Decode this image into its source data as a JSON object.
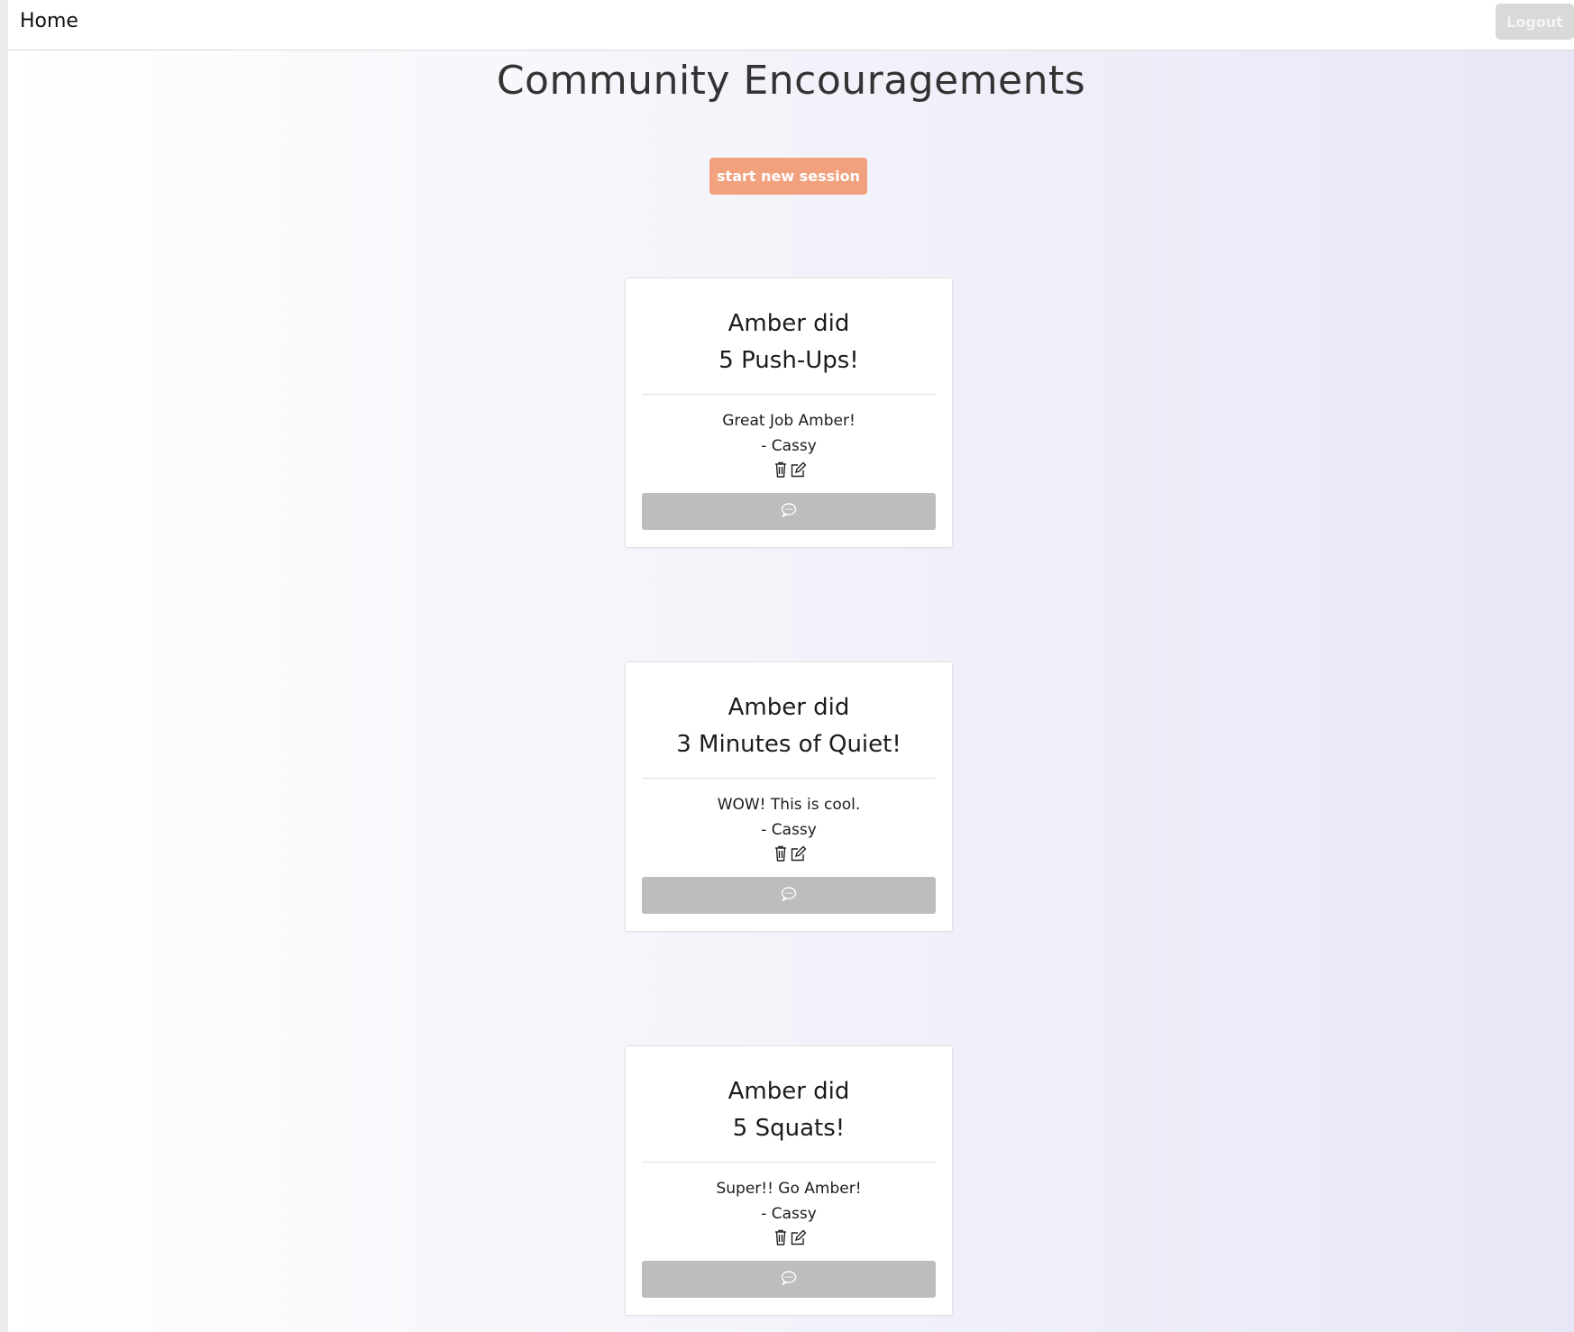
{
  "nav": {
    "home_label": "Home",
    "logout_label": "Logout"
  },
  "page": {
    "title": "Community Encouragements",
    "start_session_label": "start new session"
  },
  "cards": [
    {
      "title_line1": "Amber did",
      "title_line2": "5 Push-Ups!",
      "message": "Great Job Amber!",
      "author": "- Cassy"
    },
    {
      "title_line1": "Amber did",
      "title_line2": "3 Minutes of Quiet!",
      "message": "WOW! This is cool.",
      "author": "- Cassy"
    },
    {
      "title_line1": "Amber did",
      "title_line2": "5 Squats!",
      "message": "Super!! Go Amber!",
      "author": "- Cassy"
    }
  ],
  "colors": {
    "start_button": "#f2a17e",
    "logout_button": "#d9d9d9",
    "comment_button": "#bdbdbd"
  },
  "icons": {
    "delete": "trash-icon",
    "edit": "edit-icon",
    "comment": "comment-icon"
  }
}
